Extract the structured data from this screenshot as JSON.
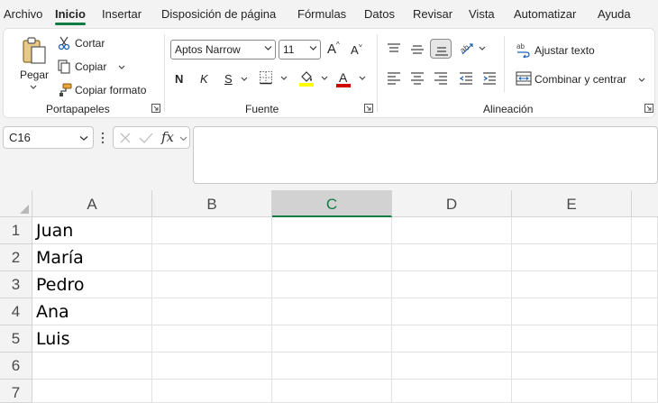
{
  "tabs": [
    "Archivo",
    "Inicio",
    "Insertar",
    "Disposición de página",
    "Fórmulas",
    "Datos",
    "Revisar",
    "Vista",
    "Automatizar",
    "Ayuda"
  ],
  "active_tab": "Inicio",
  "clipboard": {
    "paste_label": "Pegar",
    "cut_label": "Cortar",
    "copy_label": "Copiar",
    "format_painter_label": "Copiar formato",
    "group_label": "Portapapeles"
  },
  "font": {
    "font_name": "Aptos Narrow",
    "font_size": "11",
    "grow_label": "A",
    "shrink_label": "A",
    "bold_label": "N",
    "italic_label": "K",
    "underline_label": "S",
    "font_color_label": "A",
    "group_label": "Fuente",
    "fill_color": "#ffff00",
    "font_color": "#d00000"
  },
  "alignment": {
    "wrap_label": "Ajustar texto",
    "merge_label": "Combinar y centrar",
    "wrap_icon_text": "ab",
    "group_label": "Alineación"
  },
  "formula_bar": {
    "name_box": "C16",
    "fx_label": "fx",
    "formula": ""
  },
  "grid": {
    "columns": [
      "A",
      "B",
      "C",
      "D",
      "E"
    ],
    "selected_column": "C",
    "rows": [
      "1",
      "2",
      "3",
      "4",
      "5",
      "6",
      "7"
    ],
    "column_a_values": [
      "Juan",
      "María",
      "Pedro",
      "Ana",
      "Luis",
      "",
      ""
    ]
  },
  "colors": {
    "accent": "#107c41",
    "ribbon_bg": "#ffffff",
    "app_bg": "#f3f3f3"
  }
}
